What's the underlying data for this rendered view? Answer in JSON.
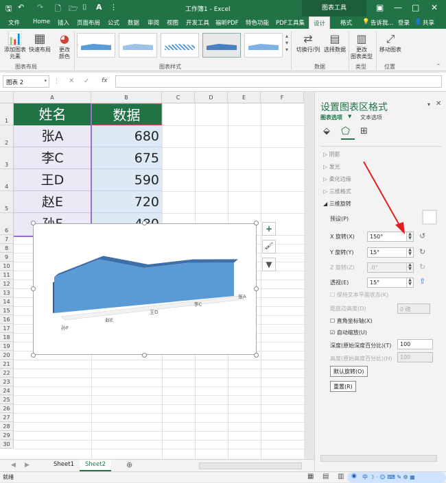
{
  "title_bar": {
    "title": "工作簿1 - Excel",
    "context_label": "图表工具",
    "min": "—",
    "restore": "□",
    "close": "✕"
  },
  "tabs": [
    "文件",
    "Home",
    "插入",
    "页面布局",
    "公式",
    "数据",
    "审阅",
    "视图",
    "开发工具",
    "福昕PDF",
    "特色功能",
    "PDF工具集",
    "设计",
    "格式"
  ],
  "active_tab": "设计",
  "tell_me": "告诉我...",
  "login": "登录",
  "share": "共享",
  "ribbon": {
    "add_element": "添加图表\n元素",
    "quick_layout": "快速布局",
    "change_colors": "更改\n颜色",
    "group_layout": "图表布局",
    "group_styles": "图表样式",
    "switch_row_col": "切换行/列",
    "select_data": "选择数据",
    "group_data": "数据",
    "change_type": "更改\n图表类型",
    "group_type": "类型",
    "move_chart": "移动图表",
    "group_location": "位置"
  },
  "formula_bar": {
    "name_box": "图表 2",
    "fx": "fx"
  },
  "grid": {
    "columns": [
      "A",
      "B",
      "C",
      "D",
      "E",
      "F"
    ],
    "rows": [
      "1",
      "2",
      "3",
      "4",
      "5",
      "6",
      "7",
      "8",
      "9",
      "10",
      "11",
      "12",
      "13",
      "14",
      "15",
      "16",
      "17",
      "18",
      "19",
      "20",
      "21",
      "22",
      "23",
      "24",
      "25",
      "26",
      "27",
      "28",
      "29",
      "30"
    ],
    "header": [
      "姓名",
      "数据"
    ],
    "data": [
      [
        "张A",
        "680"
      ],
      [
        "李C",
        "675"
      ],
      [
        "王D",
        "590"
      ],
      [
        "赵E",
        "720"
      ],
      [
        "孙F",
        "480"
      ]
    ]
  },
  "chart": {
    "x_labels": [
      "孙F",
      "赵E",
      "王D",
      "李C",
      "张A"
    ],
    "plus": "+",
    "brush": "🖌",
    "filter": "▼"
  },
  "sheets": [
    "Sheet1",
    "Sheet2"
  ],
  "active_sheet": "Sheet2",
  "status": "就绪",
  "pane": {
    "title": "设置图表区格式",
    "tab_chart_options": "图表选项",
    "tab_text_options": "文本选项",
    "sections": [
      "阴影",
      "发光",
      "柔化边缘",
      "三维格式",
      "三维旋转"
    ],
    "preset_label": "预设(P)",
    "x_rotation_label": "X 旋转(X)",
    "x_rotation_value": "150°",
    "y_rotation_label": "Y 旋转(Y)",
    "y_rotation_value": "15°",
    "z_rotation_label": "Z 旋转(Z)",
    "z_rotation_value": ".0°",
    "perspective_label": "透视(E)",
    "perspective_value": "15°",
    "keep_text_flat": "保持文本平面状态(K)",
    "distance_label": "距底边高度(D)",
    "distance_value": "0 磅",
    "right_angle_axes": "直角坐标轴(X)",
    "autoscale": "自动缩放(U)",
    "depth_label": "深度(原始深度百分比)(T)",
    "depth_value": "100",
    "height_label": "高度(原始高度百分比)(H)",
    "height_value": "100",
    "default_rotation": "默认旋转(O)",
    "reset": "重置(R)"
  }
}
